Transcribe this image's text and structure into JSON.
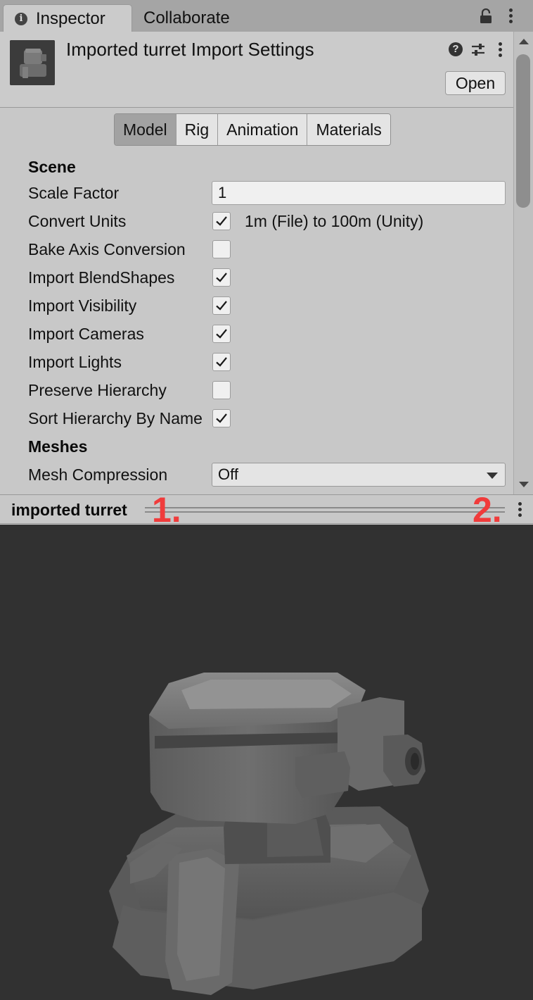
{
  "tabs": {
    "inspector": "Inspector",
    "collaborate": "Collaborate"
  },
  "header": {
    "title": "Imported turret Import Settings",
    "open_label": "Open",
    "help_glyph": "?"
  },
  "toolbar": {
    "model": "Model",
    "rig": "Rig",
    "animation": "Animation",
    "materials": "Materials",
    "active": "Model"
  },
  "scene": {
    "heading": "Scene",
    "scale_factor_label": "Scale Factor",
    "scale_factor_value": "1",
    "convert_units_label": "Convert Units",
    "convert_units_checked": true,
    "convert_units_note": "1m (File) to 100m (Unity)",
    "bake_axis_label": "Bake Axis Conversion",
    "bake_axis_checked": false,
    "import_blendshapes_label": "Import BlendShapes",
    "import_blendshapes_checked": true,
    "import_visibility_label": "Import Visibility",
    "import_visibility_checked": true,
    "import_cameras_label": "Import Cameras",
    "import_cameras_checked": true,
    "import_lights_label": "Import Lights",
    "import_lights_checked": true,
    "preserve_hierarchy_label": "Preserve Hierarchy",
    "preserve_hierarchy_checked": false,
    "sort_hierarchy_label": "Sort Hierarchy By Name",
    "sort_hierarchy_checked": true
  },
  "meshes": {
    "heading": "Meshes",
    "mesh_compression_label": "Mesh Compression",
    "mesh_compression_value": "Off"
  },
  "preview": {
    "title": "imported turret",
    "marker_1": "1.",
    "marker_2": "2."
  },
  "colors": {
    "panel_bg": "#c8c8c8",
    "tab_bar_bg": "#a5a5a5",
    "preview_bg": "#313131",
    "annotation_red": "#f03b3b"
  },
  "icons": {
    "tab_inspector": "info-icon",
    "tab_lock": "lock-icon",
    "tab_menu": "kebab-menu-icon",
    "help": "help-icon",
    "presets": "presets-sliders-icon",
    "header_menu": "kebab-menu-icon",
    "preview_menu": "kebab-menu-icon",
    "checkmark": "checkmark-icon",
    "dropdown": "chevron-down-icon"
  }
}
